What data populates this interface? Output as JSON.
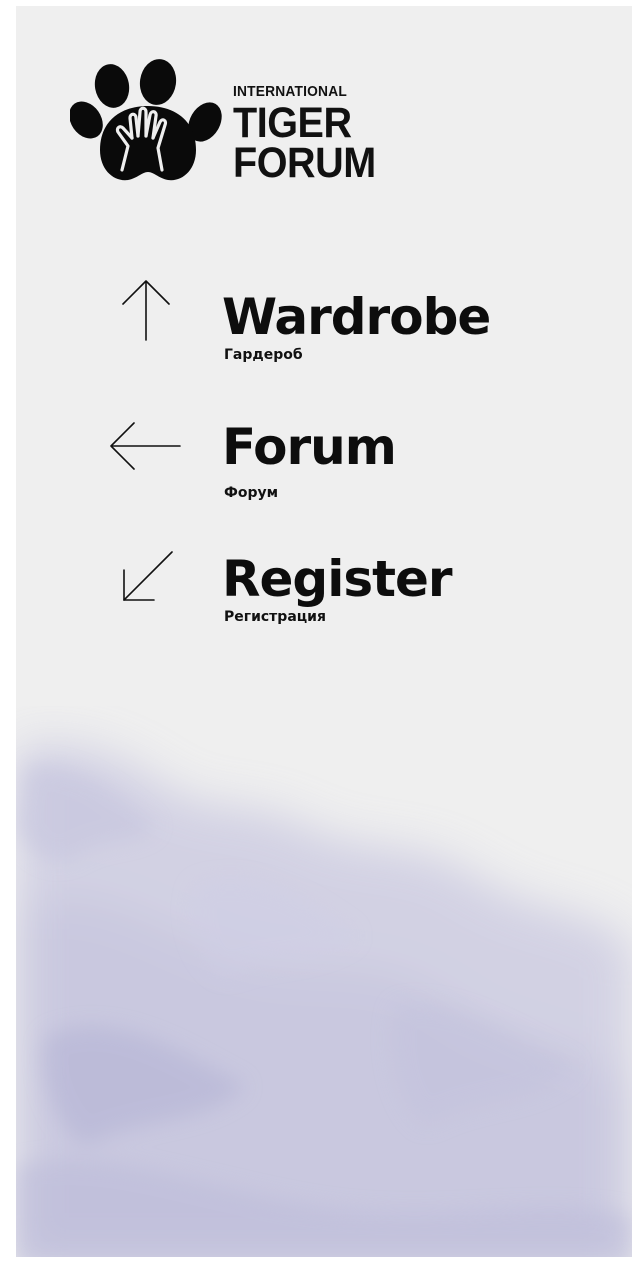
{
  "logo": {
    "line1": "INTERNATIONAL",
    "line2": "TIGER",
    "line3": "FORUM",
    "icon": "paw-with-hand-icon"
  },
  "menu": [
    {
      "label": "Wardrobe",
      "sublabel": "Гардероб",
      "icon": "arrow-up-icon"
    },
    {
      "label": "Forum",
      "sublabel": "Форум",
      "icon": "arrow-left-icon"
    },
    {
      "label": "Register",
      "sublabel": "Регистрация",
      "icon": "arrow-down-left-icon"
    }
  ],
  "colors": {
    "background": "#efefef",
    "text": "#0d0d0d",
    "watercolor": "#b9b8d8"
  }
}
